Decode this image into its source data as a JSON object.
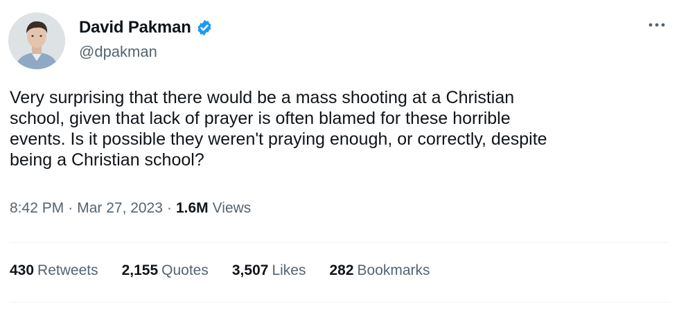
{
  "author": {
    "display_name": "David Pakman",
    "handle": "@dpakman",
    "verified_color": "#1d9bf0"
  },
  "tweet": {
    "text": "Very surprising that there would be a mass shooting at a Christian\nschool, given that lack of prayer is often blamed for these horrible\nevents. Is it possible they weren't praying enough, or correctly, despite\nbeing a Christian school?"
  },
  "meta": {
    "time": "8:42 PM",
    "sep1": "·",
    "date": "Mar 27, 2023",
    "sep2": "·",
    "views_count": "1.6M",
    "views_label": "Views"
  },
  "stats": [
    {
      "count": "430",
      "label": "Retweets"
    },
    {
      "count": "2,155",
      "label": "Quotes"
    },
    {
      "count": "3,507",
      "label": "Likes"
    },
    {
      "count": "282",
      "label": "Bookmarks"
    }
  ],
  "icons": {
    "more": "more-icon",
    "verified": "verified-badge-icon"
  }
}
